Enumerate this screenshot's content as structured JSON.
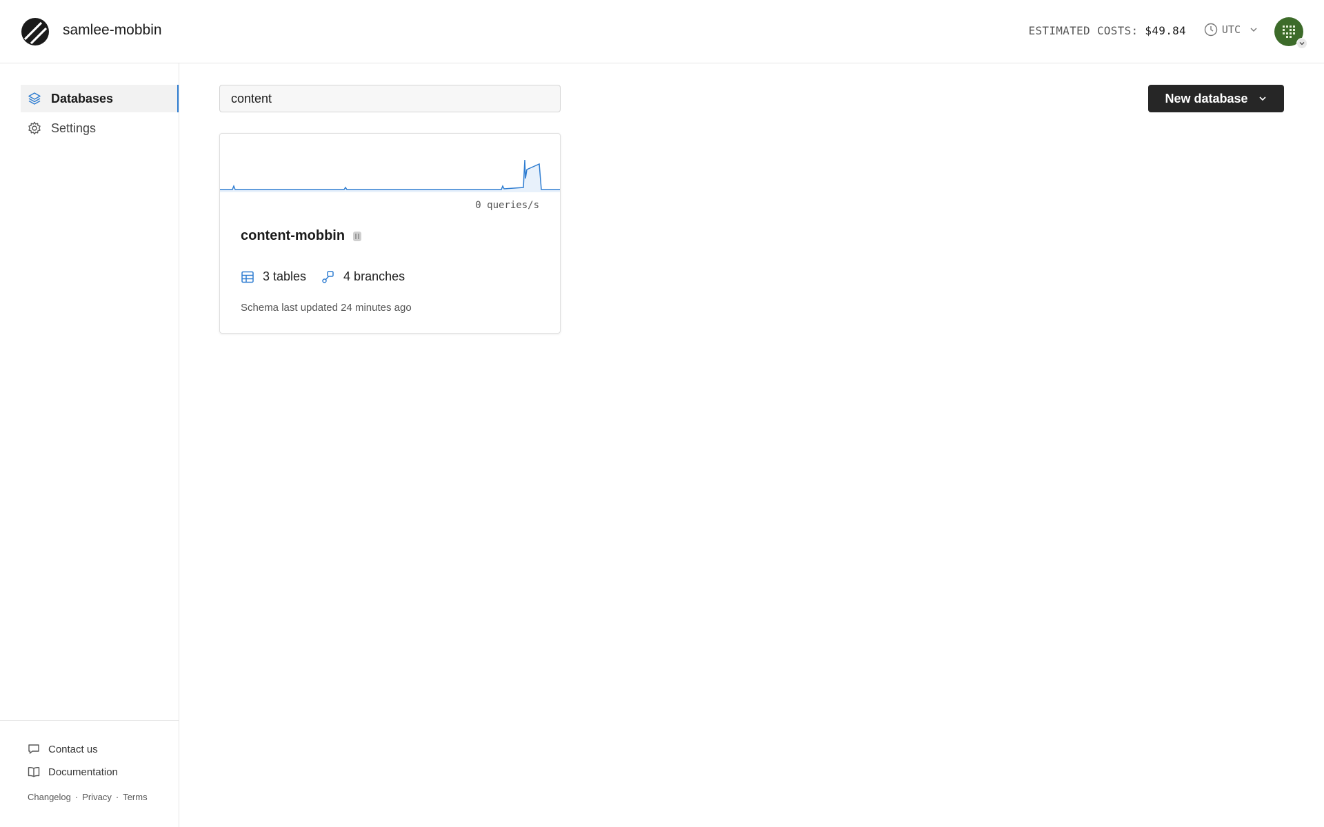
{
  "header": {
    "org_name": "samlee-mobbin",
    "costs_label": "ESTIMATED COSTS:",
    "costs_value": "$49.84",
    "timezone": "UTC"
  },
  "sidebar": {
    "items": [
      {
        "label": "Databases",
        "icon": "layers-icon",
        "active": true
      },
      {
        "label": "Settings",
        "icon": "gear-icon",
        "active": false
      }
    ],
    "footer": {
      "contact_label": "Contact us",
      "docs_label": "Documentation",
      "legal": [
        "Changelog",
        "Privacy",
        "Terms"
      ],
      "separator": "·"
    }
  },
  "main": {
    "search_value": "content",
    "new_database_label": "New database",
    "databases": [
      {
        "name": "content-mobbin",
        "queries_label": "0 queries/s",
        "tables_label": "3 tables",
        "branches_label": "4 branches",
        "schema_updated": "Schema last updated 24 minutes ago"
      }
    ]
  },
  "colors": {
    "accent": "#2f7dd1",
    "button_bg": "#262626",
    "avatar_bg": "#3d6b2a"
  }
}
